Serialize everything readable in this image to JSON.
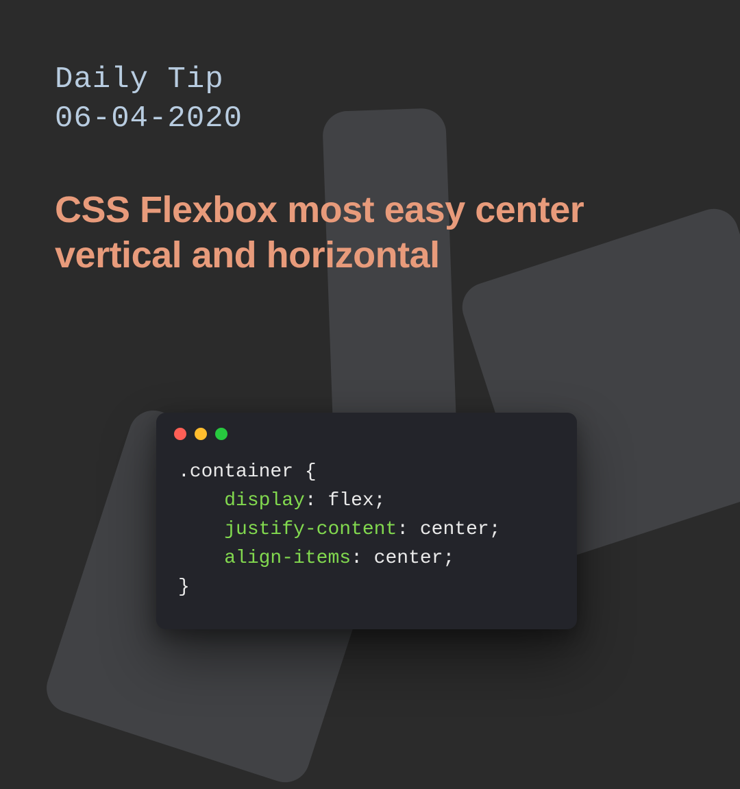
{
  "header": {
    "label": "Daily Tip",
    "date": "06-04-2020"
  },
  "title": "CSS Flexbox most easy center vertical and horizontal",
  "code": {
    "selector": ".container",
    "open_brace": "{",
    "close_brace": "}",
    "lines": [
      {
        "prop": "display",
        "colon": ":",
        "value": " flex",
        "semi": ";"
      },
      {
        "prop": "justify-content",
        "colon": ":",
        "value": " center",
        "semi": ";"
      },
      {
        "prop": "align-items",
        "colon": ":",
        "value": " center",
        "semi": ";"
      }
    ],
    "indent": "    "
  },
  "traffic_colors": {
    "red": "#ff5f56",
    "yellow": "#ffbd2e",
    "green": "#27c93f"
  }
}
